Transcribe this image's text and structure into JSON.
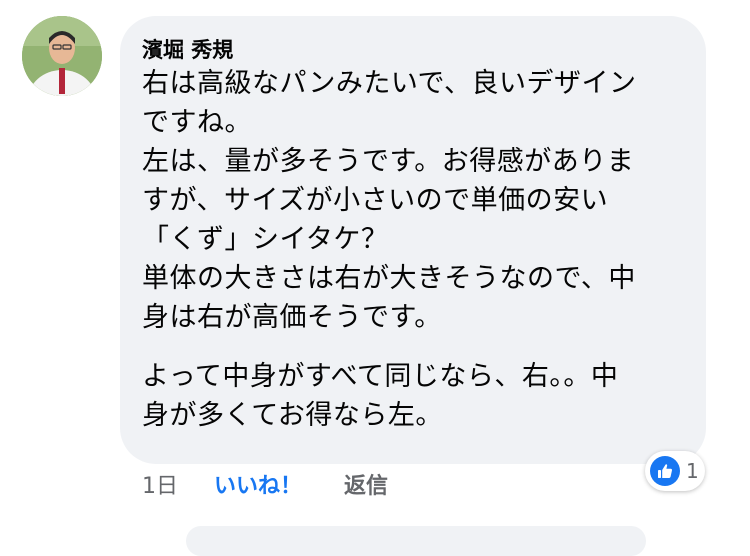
{
  "comment": {
    "author": "濱堀 秀規",
    "lines": [
      "右は高級なパンみたいで、良いデザイン",
      "ですね。",
      "左は、量が多そうです。お得感がありま",
      "すが、サイズが小さいので単価の安い",
      "「くず」シイタケ？",
      "単体の大きさは右が大きそうなので、中",
      "身は右が高価そうです。",
      "よって中身がすべて同じなら、右。。中",
      "身が多くてお得なら左。"
    ],
    "time": "1日",
    "like_label": "いいね！",
    "reply_label": "返信",
    "reaction_count": "1",
    "reaction_icon": "thumbs-up-icon",
    "colors": {
      "bubble": "#f0f2f5",
      "like_blue": "#1877f2",
      "meta_gray": "#65676b"
    }
  }
}
